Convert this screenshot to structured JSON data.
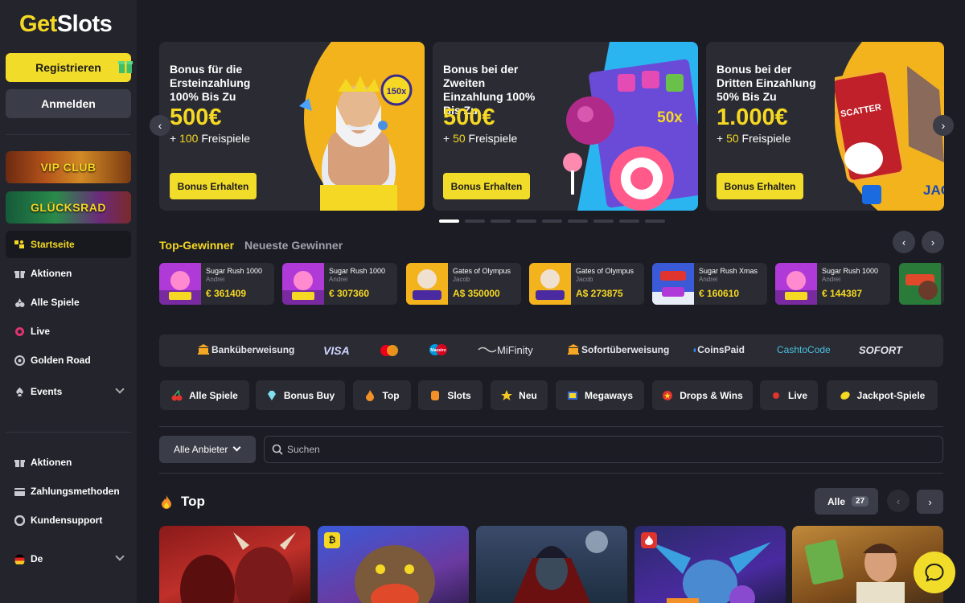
{
  "logo": {
    "part1": "Get",
    "part2": "Slots"
  },
  "auth": {
    "register": "Registrieren",
    "login": "Anmelden"
  },
  "promos": {
    "vip": "VIP CLUB",
    "wheel": "GLÜCKSRAD"
  },
  "nav": {
    "main": [
      {
        "label": "Startseite",
        "icon": "home-icon",
        "active": true
      },
      {
        "label": "Aktionen",
        "icon": "gift-icon"
      },
      {
        "label": "Alle Spiele",
        "icon": "games-icon"
      },
      {
        "label": "Live",
        "icon": "live-icon"
      },
      {
        "label": "Golden Road",
        "icon": "road-icon"
      },
      {
        "label": "Events",
        "icon": "events-icon"
      }
    ],
    "bottom": [
      {
        "label": "Aktionen",
        "icon": "gift-icon"
      },
      {
        "label": "Zahlungsmethoden",
        "icon": "wallet-icon"
      },
      {
        "label": "Kundensupport",
        "icon": "support-icon"
      }
    ],
    "language": "De"
  },
  "banners": [
    {
      "title": "Bonus für die Ersteinzahlung 100% Bis Zu",
      "amount": "500€",
      "spins_prefix": "+ ",
      "spins_num": "100",
      "spins_suffix": " Freispiele",
      "cta": "Bonus Erhalten",
      "art_text": "150x"
    },
    {
      "title": "Bonus bei der Zweiten Einzahlung 100% Bis Zu",
      "amount": "500€",
      "spins_prefix": "+ ",
      "spins_num": "50",
      "spins_suffix": " Freispiele",
      "cta": "Bonus Erhalten",
      "art_text": "50x"
    },
    {
      "title": "Bonus bei der Dritten Einzahlung 50% Bis Zu",
      "amount": "1.000€",
      "spins_prefix": "+ ",
      "spins_num": "50",
      "spins_suffix": " Freispiele",
      "cta": "Bonus Erhalten",
      "art_text": "SCATTER",
      "art_text2": "JACK"
    }
  ],
  "carousel": {
    "total": 9,
    "active": 0
  },
  "winners": {
    "tabs": [
      "Top-Gewinner",
      "Neueste Gewinner"
    ],
    "items": [
      {
        "game": "Sugar Rush 1000",
        "user": "Andrei",
        "amount": "€ 361409",
        "thumb": "sugar"
      },
      {
        "game": "Sugar Rush 1000",
        "user": "Andrei",
        "amount": "€ 307360",
        "thumb": "sugar"
      },
      {
        "game": "Gates of Olympus",
        "user": "Jacob",
        "amount": "A$ 350000",
        "thumb": "olympus"
      },
      {
        "game": "Gates of Olympus",
        "user": "Jacob",
        "amount": "A$ 273875",
        "thumb": "olympus"
      },
      {
        "game": "Sugar Rush Xmas",
        "user": "Andrei",
        "amount": "€ 160610",
        "thumb": "xmas"
      },
      {
        "game": "Sugar Rush 1000",
        "user": "Andrei",
        "amount": "€ 144387",
        "thumb": "sugar"
      }
    ]
  },
  "payments": [
    "Banküberweisung",
    "VISA",
    "",
    "Maestro",
    "MiFinity",
    "Sofortüberweisung",
    "CoinsPaid",
    "CashtoCode",
    "SOFORT"
  ],
  "categories": [
    {
      "label": "Alle Spiele",
      "icon": "cherry-icon",
      "color": "#e0342f"
    },
    {
      "label": "Bonus Buy",
      "icon": "diamond-icon",
      "color": "#7fe0f0"
    },
    {
      "label": "Top",
      "icon": "flame-icon",
      "color": "#f2902a"
    },
    {
      "label": "Slots",
      "icon": "slot-icon",
      "color": "#f2902a"
    },
    {
      "label": "Neu",
      "icon": "star-icon",
      "color": "#f5c823"
    },
    {
      "label": "Megaways",
      "icon": "megaways-icon",
      "color": "#f5d823"
    },
    {
      "label": "Drops & Wins",
      "icon": "drops-icon",
      "color": "#e0342f"
    },
    {
      "label": "Live",
      "icon": "live-dot-icon",
      "color": "#e0342f"
    },
    {
      "label": "Jackpot-Spiele",
      "icon": "lemon-icon",
      "color": "#f5d823"
    }
  ],
  "filter": {
    "provider": "Alle Anbieter",
    "search_placeholder": "Suchen"
  },
  "top_section": {
    "title": "Top",
    "all_label": "Alle",
    "all_count": "27"
  },
  "top_badges": {
    "crypto": "₿"
  }
}
